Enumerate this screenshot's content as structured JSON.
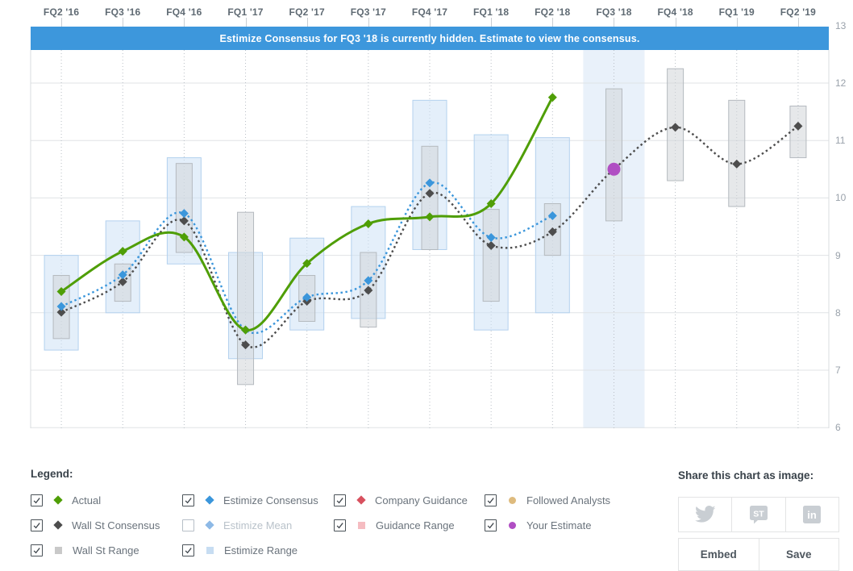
{
  "banner": {
    "text": "Estimize Consensus for FQ3 '18 is currently hidden. Estimate to view the consensus.",
    "color": "#3d97dc"
  },
  "chart_data": {
    "type": "line",
    "title": "Quarterly estimates chart",
    "categories": [
      "FQ2 '16",
      "FQ3 '16",
      "FQ4 '16",
      "FQ1 '17",
      "FQ2 '17",
      "FQ3 '17",
      "FQ4 '17",
      "FQ1 '18",
      "FQ2 '18",
      "FQ3 '18",
      "FQ4 '18",
      "FQ1 '19",
      "FQ2 '19"
    ],
    "y_axis": {
      "min": 6,
      "max": 13,
      "ticks": [
        13,
        12,
        11,
        10,
        9,
        8,
        7,
        6
      ],
      "position": "right",
      "grid": true
    },
    "highlighted_category": "FQ3 '18",
    "highlight_color": "#e9f1fa",
    "series": [
      {
        "name": "Wall St Consensus",
        "style": "dotted",
        "marker": "diamond",
        "color": "#4d4d4d",
        "values": [
          8.01,
          8.54,
          9.6,
          7.44,
          8.2,
          8.39,
          10.08,
          9.17,
          9.41,
          10.5,
          11.23,
          10.59,
          11.25
        ]
      },
      {
        "name": "Estimize Consensus",
        "style": "dotted",
        "marker": "diamond",
        "color": "#3b96db",
        "values": [
          8.11,
          8.66,
          9.73,
          7.7,
          8.27,
          8.56,
          10.26,
          9.31,
          9.69,
          null,
          null,
          null,
          null
        ]
      },
      {
        "name": "Actual",
        "style": "solid",
        "marker": "diamond",
        "color": "#4f9e06",
        "values": [
          8.37,
          9.07,
          9.32,
          7.7,
          8.86,
          9.55,
          9.67,
          9.9,
          11.75,
          null,
          null,
          null,
          null
        ]
      },
      {
        "name": "Your Estimate",
        "style": "points",
        "marker": "circle",
        "color": "#b04ec3",
        "values": [
          null,
          null,
          null,
          null,
          null,
          null,
          null,
          null,
          null,
          10.5,
          null,
          null,
          null
        ]
      }
    ],
    "ranges": [
      {
        "name": "Estimize Range",
        "fill": "rgba(205,225,245,0.55)",
        "stroke": "#b3d1ee",
        "width": 42,
        "low": [
          7.35,
          8.0,
          8.85,
          7.2,
          7.7,
          7.9,
          9.1,
          7.7,
          8.0,
          null,
          null,
          null,
          null
        ],
        "high": [
          9.0,
          9.6,
          10.7,
          9.05,
          9.3,
          9.85,
          11.7,
          11.1,
          11.05,
          null,
          null,
          null,
          null
        ]
      },
      {
        "name": "Wall St Range",
        "fill": "rgba(209,213,216,0.55)",
        "stroke": "#b5babf",
        "width": 20,
        "low": [
          7.55,
          8.2,
          9.05,
          6.75,
          7.85,
          7.75,
          9.1,
          8.2,
          9.0,
          9.6,
          10.3,
          9.85,
          10.7
        ],
        "high": [
          8.65,
          8.85,
          10.6,
          9.75,
          8.65,
          9.05,
          10.9,
          9.8,
          9.9,
          11.9,
          12.25,
          11.7,
          11.6
        ]
      }
    ]
  },
  "legend": {
    "title": "Legend:",
    "items": [
      {
        "col": 0,
        "checked": true,
        "shape": "diamond",
        "color": "#4f9e06",
        "label": "Actual"
      },
      {
        "col": 0,
        "checked": true,
        "shape": "diamond",
        "color": "#4d4d4d",
        "label": "Wall St Consensus"
      },
      {
        "col": 0,
        "checked": true,
        "shape": "square",
        "color": "#c9c9c9",
        "label": "Wall St Range"
      },
      {
        "col": 1,
        "checked": true,
        "shape": "diamond",
        "color": "#3b96db",
        "label": "Estimize Consensus"
      },
      {
        "col": 1,
        "checked": false,
        "shape": "diamond",
        "color": "#8db9e6",
        "label": "Estimize Mean",
        "muted": true
      },
      {
        "col": 1,
        "checked": true,
        "shape": "square",
        "color": "#c7ddf2",
        "label": "Estimize Range"
      },
      {
        "col": 2,
        "checked": true,
        "shape": "diamond",
        "color": "#d8515f",
        "label": "Company Guidance"
      },
      {
        "col": 2,
        "checked": true,
        "shape": "square",
        "color": "#f5bcc1",
        "label": "Guidance Range"
      },
      {
        "col": 3,
        "checked": true,
        "shape": "circle",
        "color": "#debb7e",
        "label": "Followed Analysts"
      },
      {
        "col": 3,
        "checked": true,
        "shape": "circle",
        "color": "#b04ec3",
        "label": "Your Estimate"
      }
    ]
  },
  "share": {
    "title": "Share this chart as image:",
    "social": [
      {
        "icon": "twitter-icon",
        "name": "twitter"
      },
      {
        "icon": "stocktwits-icon",
        "name": "stocktwits",
        "glyph": "ST"
      },
      {
        "icon": "linkedin-icon",
        "name": "linkedin",
        "glyph": "in"
      }
    ],
    "buttons": [
      {
        "label": "Embed"
      },
      {
        "label": "Save"
      }
    ]
  }
}
